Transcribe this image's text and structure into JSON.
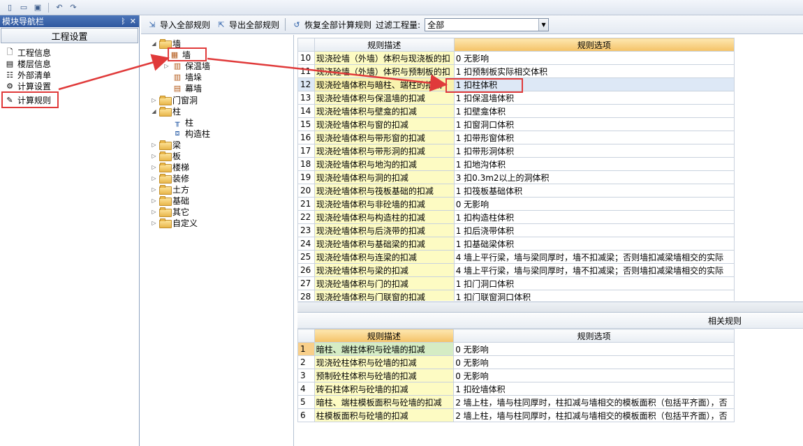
{
  "quickbar": {
    "icons": [
      "new-file-icon",
      "open-folder-icon",
      "save-icon",
      "undo-icon",
      "redo-icon"
    ]
  },
  "nav": {
    "title": "模块导航栏",
    "pin": "ᛒ",
    "close": "✕",
    "tab": "工程设置",
    "items": [
      {
        "label": "工程信息",
        "icon": "project-info-icon"
      },
      {
        "label": "楼层信息",
        "icon": "floor-info-icon"
      },
      {
        "label": "外部清单",
        "icon": "external-list-icon"
      },
      {
        "label": "计算设置",
        "icon": "calc-settings-icon"
      },
      {
        "label": "计算规则",
        "icon": "calc-rules-icon"
      }
    ],
    "active_index": 4
  },
  "toolbar": {
    "import_label": "导入全部规则",
    "export_label": "导出全部规则",
    "restore_label": "恢复全部计算规则",
    "filter_label": "过滤工程量:",
    "filter_value": "全部"
  },
  "tree": {
    "wall": "墙",
    "wall_children": [
      "墙",
      "保温墙",
      "墙垛",
      "幕墙"
    ],
    "door_window": "门窗洞",
    "column": "柱",
    "column_children": [
      "柱",
      "构造柱"
    ],
    "others": [
      "梁",
      "板",
      "楼梯",
      "装修",
      "土方",
      "基础",
      "其它",
      "自定义"
    ]
  },
  "upper_grid": {
    "col_desc": "规则描述",
    "col_opt": "规则选项",
    "rows": [
      {
        "n": "10",
        "desc": "现浇砼墙（外墙）体积与现浇板的扣",
        "opt": "0  无影响"
      },
      {
        "n": "11",
        "desc": "现浇砼墙（外墙）体积与预制板的扣",
        "opt": "1  扣预制板实际相交体积"
      },
      {
        "n": "12",
        "desc": "现浇砼墙体积与暗柱、端柱的扣减",
        "opt": "1  扣柱体积"
      },
      {
        "n": "13",
        "desc": "现浇砼墙体积与保温墙的扣减",
        "opt": "1  扣保温墙体积"
      },
      {
        "n": "14",
        "desc": "现浇砼墙体积与壁龛的扣减",
        "opt": "1  扣壁龛体积"
      },
      {
        "n": "15",
        "desc": "现浇砼墙体积与窗的扣减",
        "opt": "1 扣窗洞口体积"
      },
      {
        "n": "16",
        "desc": "现浇砼墙体积与带形窗的扣减",
        "opt": "1 扣带形窗体积"
      },
      {
        "n": "17",
        "desc": "现浇砼墙体积与带形洞的扣减",
        "opt": "1 扣带形洞体积"
      },
      {
        "n": "18",
        "desc": "现浇砼墙体积与地沟的扣减",
        "opt": "1  扣地沟体积"
      },
      {
        "n": "19",
        "desc": "现浇砼墙体积与洞的扣减",
        "opt": "3 扣0.3m2以上的洞体积"
      },
      {
        "n": "20",
        "desc": "现浇砼墙体积与筏板基础的扣减",
        "opt": "1  扣筏板基础体积"
      },
      {
        "n": "21",
        "desc": "现浇砼墙体积与非砼墙的扣减",
        "opt": "0  无影响"
      },
      {
        "n": "22",
        "desc": "现浇砼墙体积与构造柱的扣减",
        "opt": "1  扣构造柱体积"
      },
      {
        "n": "23",
        "desc": "现浇砼墙体积与后浇带的扣减",
        "opt": "1    扣后浇带体积"
      },
      {
        "n": "24",
        "desc": "现浇砼墙体积与基础梁的扣减",
        "opt": "1  扣基础梁体积"
      },
      {
        "n": "25",
        "desc": "现浇砼墙体积与连梁的扣减",
        "opt": "4  墙上平行梁，墙与梁同厚时，墙不扣减梁；否则墙扣减梁墙相交的实际"
      },
      {
        "n": "26",
        "desc": "现浇砼墙体积与梁的扣减",
        "opt": "4  墙上平行梁，墙与梁同厚时，墙不扣减梁；否则墙扣减梁墙相交的实际"
      },
      {
        "n": "27",
        "desc": "现浇砼墙体积与门的扣减",
        "opt": "1 扣门洞口体积"
      },
      {
        "n": "28",
        "desc": "现浇砼墙体积与门联窗的扣减",
        "opt": "1 扣门联窗洞口体积"
      }
    ],
    "selected_index": 2
  },
  "related": {
    "title": "相关规则",
    "col_desc": "规则描述",
    "col_opt": "规则选项",
    "rows": [
      {
        "n": "1",
        "desc": "暗柱、端柱体积与砼墙的扣减",
        "opt": "0  无影响"
      },
      {
        "n": "2",
        "desc": "现浇砼柱体积与砼墙的扣减",
        "opt": "0  无影响"
      },
      {
        "n": "3",
        "desc": "预制砼柱体积与砼墙的扣减",
        "opt": "0  无影响"
      },
      {
        "n": "4",
        "desc": "砖石柱体积与砼墙的扣减",
        "opt": "1 扣砼墙体积"
      },
      {
        "n": "5",
        "desc": "暗柱、端柱模板面积与砼墙的扣减",
        "opt": "2 墙上柱，墙与柱同厚时，柱扣减与墙相交的模板面积（包括平齐面），否"
      },
      {
        "n": "6",
        "desc": "柱模板面积与砼墙的扣减",
        "opt": "2 墙上柱，墙与柱同厚时，柱扣减与墙相交的模板面积（包括平齐面），否"
      }
    ]
  },
  "colors": {
    "accent_red": "#e03a3a",
    "desc_bg": "#fdfbc3",
    "header_hl": "#f4c266"
  }
}
